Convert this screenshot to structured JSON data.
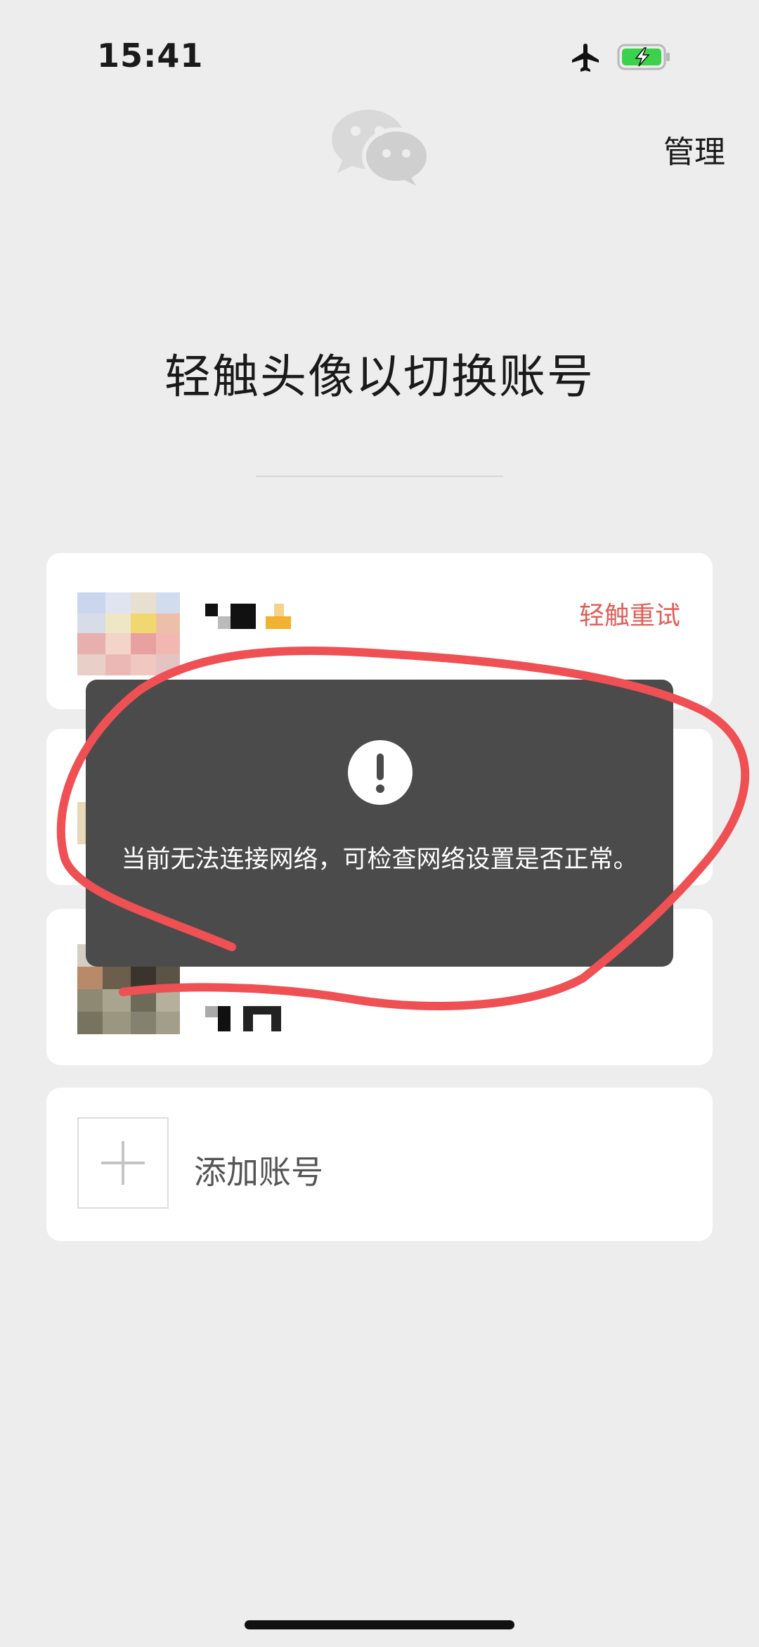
{
  "status_bar": {
    "time": "15:41",
    "battery_color": "#3ad24a"
  },
  "header": {
    "manage_label": "管理"
  },
  "title": "轻触头像以切换账号",
  "accounts": [
    {
      "retry_label": "轻触重试"
    },
    {},
    {}
  ],
  "add_account": {
    "label": "添加账号"
  },
  "toast": {
    "message": "当前无法连接网络，可检查网络设置是否正常。"
  },
  "colors": {
    "background": "#ededed",
    "accent_red": "#e0605a",
    "toast_bg": "#4b4b4b"
  }
}
